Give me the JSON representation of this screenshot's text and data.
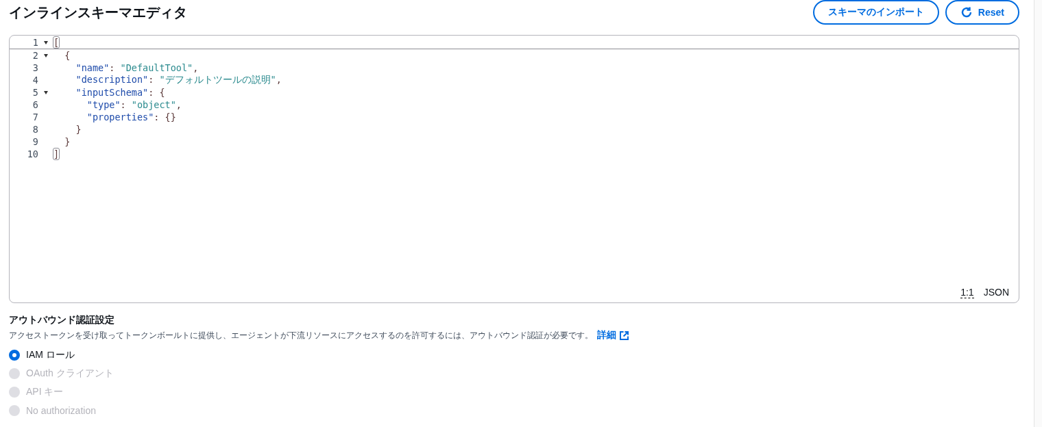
{
  "header": {
    "title": "インラインスキーマエディタ",
    "buttons": [
      {
        "kind": "plain",
        "label": "スキーマのインポート"
      },
      {
        "kind": "reset",
        "label": "Reset"
      }
    ]
  },
  "editor": {
    "lines": [
      {
        "number": "1",
        "fold": true,
        "tokens": [
          {
            "kind": "bracket",
            "text": "[",
            "matched": true
          }
        ]
      },
      {
        "number": "2",
        "fold": true,
        "tokens": [
          {
            "kind": "punct",
            "text": "  {"
          }
        ]
      },
      {
        "number": "3",
        "fold": false,
        "tokens": [
          {
            "kind": "key",
            "text": "    \"name\""
          },
          {
            "kind": "punct",
            "text": ": "
          },
          {
            "kind": "string",
            "text": "\"DefaultTool\""
          },
          {
            "kind": "punct",
            "text": ","
          }
        ]
      },
      {
        "number": "4",
        "fold": false,
        "tokens": [
          {
            "kind": "key",
            "text": "    \"description\""
          },
          {
            "kind": "punct",
            "text": ": "
          },
          {
            "kind": "string",
            "text": "\"デフォルトツールの説明\""
          },
          {
            "kind": "punct",
            "text": ","
          }
        ]
      },
      {
        "number": "5",
        "fold": true,
        "tokens": [
          {
            "kind": "key",
            "text": "    \"inputSchema\""
          },
          {
            "kind": "punct",
            "text": ": {"
          }
        ]
      },
      {
        "number": "6",
        "fold": false,
        "tokens": [
          {
            "kind": "key",
            "text": "      \"type\""
          },
          {
            "kind": "punct",
            "text": ": "
          },
          {
            "kind": "string",
            "text": "\"object\""
          },
          {
            "kind": "punct",
            "text": ","
          }
        ]
      },
      {
        "number": "7",
        "fold": false,
        "tokens": [
          {
            "kind": "key",
            "text": "      \"properties\""
          },
          {
            "kind": "punct",
            "text": ": {}"
          }
        ]
      },
      {
        "number": "8",
        "fold": false,
        "tokens": [
          {
            "kind": "punct",
            "text": "    }"
          }
        ]
      },
      {
        "number": "9",
        "fold": false,
        "tokens": [
          {
            "kind": "punct",
            "text": "  }"
          }
        ]
      },
      {
        "number": "10",
        "fold": false,
        "tokens": [
          {
            "kind": "bracket",
            "text": "]",
            "matched": true
          }
        ]
      }
    ],
    "status_bar": {
      "cursor": "1:1",
      "language": "JSON"
    }
  },
  "auth": {
    "title": "アウトバウンド認証設定",
    "description": "アクセストークンを受け取ってトークンボールトに提供し、エージェントが下流リソースにアクセスするのを許可するには、アウトバウンド認証が必要です。",
    "link": "詳細",
    "options": [
      {
        "label": "IAM ロール",
        "selected": true,
        "disabled": false
      },
      {
        "label": "OAuth クライアント",
        "selected": false,
        "disabled": true
      },
      {
        "label": "API キー",
        "selected": false,
        "disabled": true
      },
      {
        "label": "No authorization",
        "selected": false,
        "disabled": true
      }
    ]
  }
}
